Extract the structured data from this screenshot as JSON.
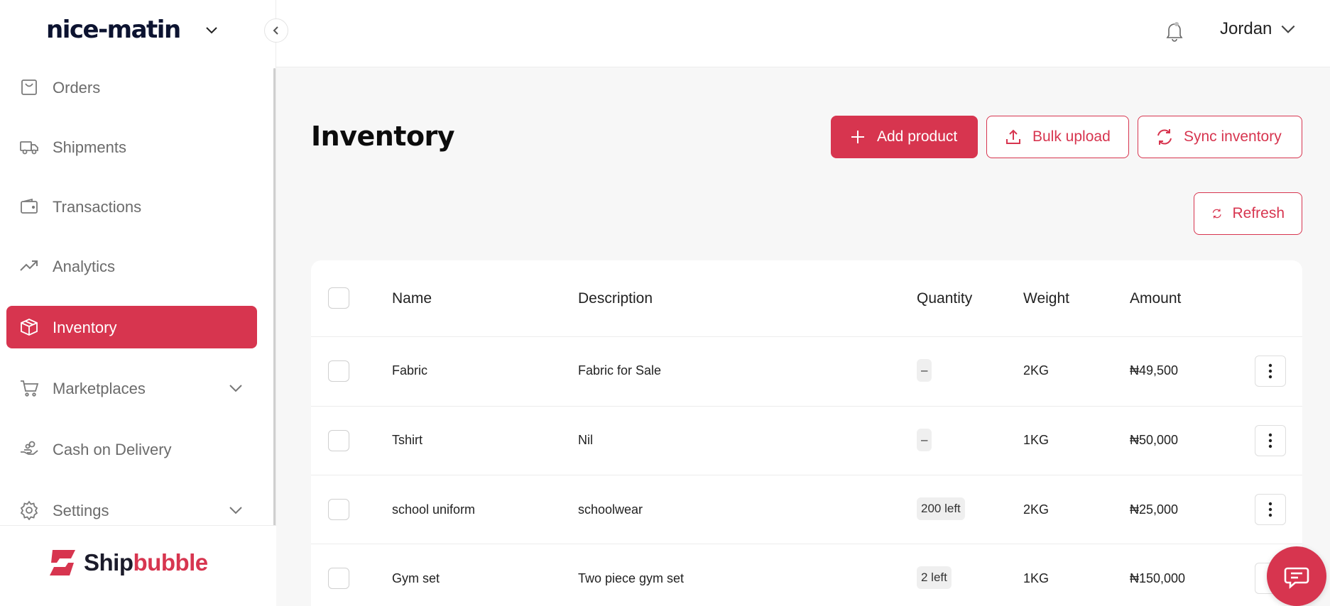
{
  "brand": {
    "name": "nice-matin"
  },
  "colors": {
    "accent": "#d7354f",
    "sidebar_text": "#6b6b6b",
    "page_bg": "#f7f7f7"
  },
  "sidebar": {
    "items": [
      {
        "label": "Orders",
        "icon": "shopping-bag-icon",
        "active": false
      },
      {
        "label": "Shipments",
        "icon": "truck-icon",
        "active": false
      },
      {
        "label": "Transactions",
        "icon": "wallet-icon",
        "active": false
      },
      {
        "label": "Analytics",
        "icon": "trend-up-icon",
        "active": false
      },
      {
        "label": "Inventory",
        "icon": "box-icon",
        "active": true
      },
      {
        "label": "Marketplaces",
        "icon": "cart-icon",
        "active": false,
        "expandable": true
      },
      {
        "label": "Cash on Delivery",
        "icon": "hand-coins-icon",
        "active": false
      },
      {
        "label": "Settings",
        "icon": "gear-icon",
        "active": false,
        "expandable": true
      }
    ],
    "footer_logo": {
      "part1": "Ship",
      "part2": "bubble"
    }
  },
  "topbar": {
    "user_name": "Jordan"
  },
  "page": {
    "title": "Inventory",
    "actions": {
      "add_product": "Add product",
      "bulk_upload": "Bulk upload",
      "sync_inventory": "Sync inventory",
      "refresh": "Refresh"
    }
  },
  "table": {
    "columns": [
      "Name",
      "Description",
      "Quantity",
      "Weight",
      "Amount"
    ],
    "rows": [
      {
        "name": "Fabric",
        "description": "Fabric for Sale",
        "quantity": "–",
        "weight": "2KG",
        "amount": "₦49,500"
      },
      {
        "name": "Tshirt",
        "description": "Nil",
        "quantity": "–",
        "weight": "1KG",
        "amount": "₦50,000"
      },
      {
        "name": "school uniform",
        "description": "schoolwear",
        "quantity": "200 left",
        "weight": "2KG",
        "amount": "₦25,000"
      },
      {
        "name": "Gym set",
        "description": "Two piece gym set",
        "quantity": "2 left",
        "weight": "1KG",
        "amount": "₦150,000"
      }
    ]
  }
}
